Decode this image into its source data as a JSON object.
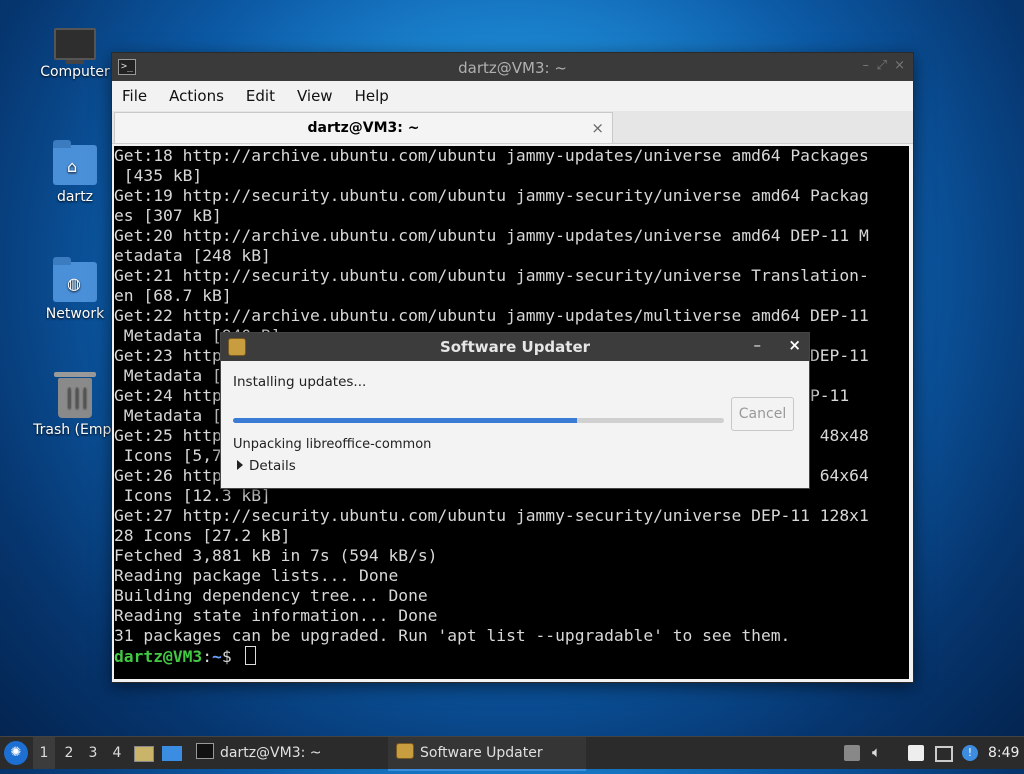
{
  "desktop": {
    "icons": [
      {
        "label": "Computer",
        "icon": "computer-icon"
      },
      {
        "label": "dartz",
        "icon": "home-folder-icon"
      },
      {
        "label": "Network",
        "icon": "network-folder-icon"
      },
      {
        "label": "Trash (Empt",
        "icon": "trash-icon"
      }
    ]
  },
  "terminal": {
    "window_title": "dartz@VM3: ~",
    "menu": [
      "File",
      "Actions",
      "Edit",
      "View",
      "Help"
    ],
    "tab_label": "dartz@VM3: ~",
    "lines": [
      "Get:18 http://archive.ubuntu.com/ubuntu jammy-updates/universe amd64 Packages",
      " [435 kB]",
      "Get:19 http://security.ubuntu.com/ubuntu jammy-security/universe amd64 Packag",
      "es [307 kB]",
      "Get:20 http://archive.ubuntu.com/ubuntu jammy-updates/universe amd64 DEP-11 M",
      "etadata [248 kB]",
      "Get:21 http://security.ubuntu.com/ubuntu jammy-security/universe Translation-",
      "en [68.7 kB]",
      "Get:22 http://archive.ubuntu.com/ubuntu jammy-updates/multiverse amd64 DEP-11",
      " Metadata [940 B]",
      "Get:23 http://security.ubuntu.com/ubuntu jammy-security/universe amd64 DEP-11",
      " Metadata [",
      "Get:24 http://archive.ubuntu.com/ubuntu jammy-updates/universe amd64 DEP-11",
      " Metadata [",
      "Get:25 http://security.ubuntu.com/ubuntu jammy-security/universe DEP-11 48x48",
      " Icons [5,7",
      "Get:26 http://security.ubuntu.com/ubuntu jammy-security/universe DEP-11 64x64",
      " Icons [12.3 kB]",
      "Get:27 http://security.ubuntu.com/ubuntu jammy-security/universe DEP-11 128x1",
      "28 Icons [27.2 kB]",
      "Fetched 3,881 kB in 7s (594 kB/s)",
      "Reading package lists... Done",
      "Building dependency tree... Done",
      "Reading state information... Done",
      "31 packages can be upgraded. Run 'apt list --upgradable' to see them."
    ],
    "prompt_user": "dartz@VM3",
    "prompt_sep": ":",
    "prompt_path": "~",
    "prompt_dollar": "$ "
  },
  "dialog": {
    "title": "Software Updater",
    "min_glyph": "–",
    "close_glyph": "×",
    "status": "Installing updates...",
    "progress": 0.7,
    "cancel_label": "Cancel",
    "current_action": "Unpacking libreoffice-common",
    "details_label": "Details"
  },
  "taskbar": {
    "workspaces": [
      "1",
      "2",
      "3",
      "4"
    ],
    "active_workspace": "1",
    "tasks": [
      {
        "label": "dartz@VM3: ~",
        "icon": "terminal-icon"
      },
      {
        "label": "Software Updater",
        "icon": "software-updater-icon"
      }
    ],
    "clock": "8:49"
  },
  "colors": {
    "accent": "#3a7bd5",
    "prompt_user": "#43c843",
    "prompt_path": "#6aa1ff",
    "terminal_bg": "#000000"
  }
}
